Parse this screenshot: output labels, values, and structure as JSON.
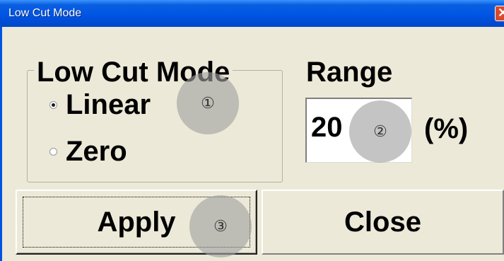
{
  "window": {
    "title": "Low Cut Mode",
    "close_glyph": "✕"
  },
  "groupbox": {
    "label": "Low Cut Mode",
    "options": [
      {
        "label": "Linear",
        "checked": true
      },
      {
        "label": "Zero",
        "checked": false
      }
    ]
  },
  "range": {
    "label": "Range",
    "value": "20",
    "unit": "(%)"
  },
  "buttons": {
    "apply": "Apply",
    "close": "Close"
  },
  "markers": [
    "①",
    "②",
    "③"
  ]
}
